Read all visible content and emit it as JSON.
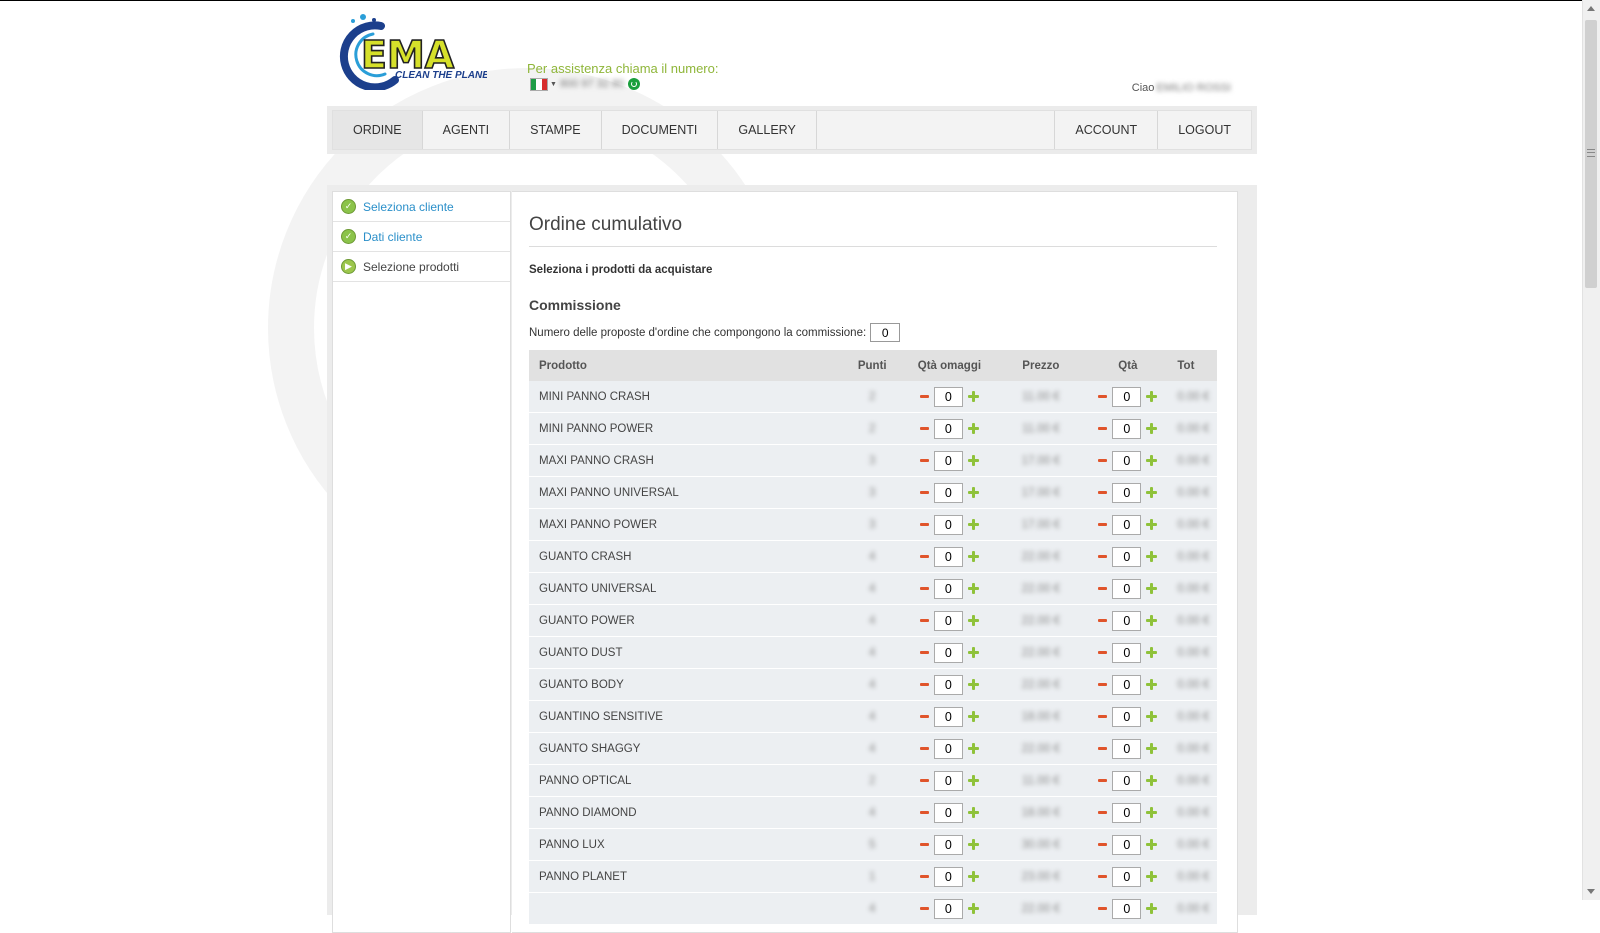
{
  "header": {
    "brand": "EMA",
    "tagline": "CLEAN THE PLANET",
    "assistance": "Per assistenza chiama il numero:",
    "greeting": "Ciao"
  },
  "colors": {
    "accent_green": "#8fb63a",
    "link_blue": "#2a8fc9",
    "minus_red": "#e0542b",
    "plus_green": "#8fc23a"
  },
  "nav": {
    "left": [
      "ORDINE",
      "AGENTI",
      "STAMPE",
      "DOCUMENTI",
      "GALLERY"
    ],
    "right": [
      "ACCOUNT",
      "LOGOUT"
    ],
    "active": "ORDINE"
  },
  "steps": [
    {
      "label": "Seleziona cliente",
      "status": "done"
    },
    {
      "label": "Dati cliente",
      "status": "done"
    },
    {
      "label": "Selezione prodotti",
      "status": "current"
    }
  ],
  "main": {
    "title": "Ordine cumulativo",
    "subtitle": "Seleziona i prodotti da acquistare",
    "section": "Commissione",
    "proposals_label": "Numero delle proposte d'ordine che compongono la commissione:",
    "proposals_value": "0"
  },
  "table": {
    "headers": {
      "product": "Prodotto",
      "points": "Punti",
      "free_qty": "Qtà omaggi",
      "price": "Prezzo",
      "qty": "Qtà",
      "total": "Tot"
    },
    "rows": [
      {
        "name": "MINI PANNO CRASH",
        "free_qty": "0",
        "qty": "0"
      },
      {
        "name": "MINI PANNO POWER",
        "free_qty": "0",
        "qty": "0"
      },
      {
        "name": "MAXI PANNO CRASH",
        "free_qty": "0",
        "qty": "0"
      },
      {
        "name": "MAXI PANNO UNIVERSAL",
        "free_qty": "0",
        "qty": "0"
      },
      {
        "name": "MAXI PANNO POWER",
        "free_qty": "0",
        "qty": "0"
      },
      {
        "name": "GUANTO CRASH",
        "free_qty": "0",
        "qty": "0"
      },
      {
        "name": "GUANTO UNIVERSAL",
        "free_qty": "0",
        "qty": "0"
      },
      {
        "name": "GUANTO POWER",
        "free_qty": "0",
        "qty": "0"
      },
      {
        "name": "GUANTO DUST",
        "free_qty": "0",
        "qty": "0"
      },
      {
        "name": "GUANTO BODY",
        "free_qty": "0",
        "qty": "0"
      },
      {
        "name": "GUANTINO SENSITIVE",
        "free_qty": "0",
        "qty": "0"
      },
      {
        "name": "GUANTO SHAGGY",
        "free_qty": "0",
        "qty": "0"
      },
      {
        "name": "PANNO OPTICAL",
        "free_qty": "0",
        "qty": "0"
      },
      {
        "name": "PANNO DIAMOND",
        "free_qty": "0",
        "qty": "0"
      },
      {
        "name": "PANNO LUX",
        "free_qty": "0",
        "qty": "0"
      },
      {
        "name": "PANNO PLANET",
        "free_qty": "0",
        "qty": "0"
      },
      {
        "name": "",
        "free_qty": "0",
        "qty": "0"
      }
    ]
  }
}
